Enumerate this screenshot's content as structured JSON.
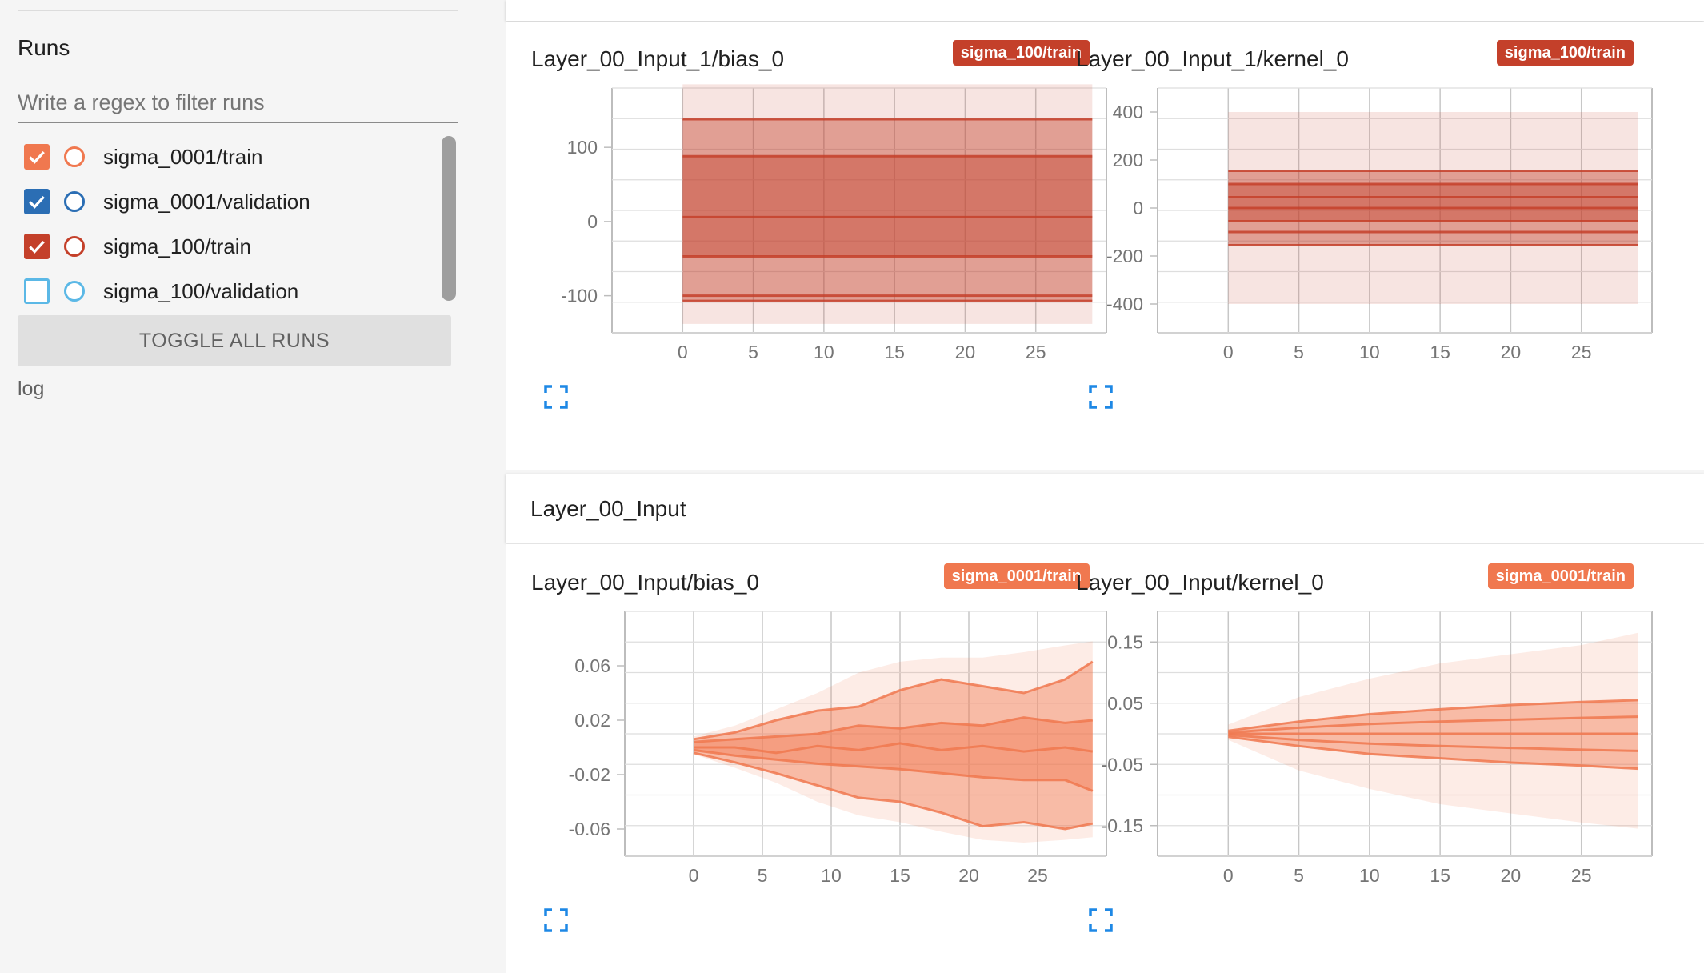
{
  "sidebar": {
    "title": "Runs",
    "filter_placeholder": "Write a regex to filter runs",
    "runs": [
      {
        "label": "sigma_0001/train",
        "checked": true,
        "color": "#f0784f"
      },
      {
        "label": "sigma_0001/validation",
        "checked": true,
        "color": "#2b6eb4"
      },
      {
        "label": "sigma_100/train",
        "checked": true,
        "color": "#c4402a"
      },
      {
        "label": "sigma_100/validation",
        "checked": false,
        "color": "#5bb8e6"
      }
    ],
    "toggle_label": "TOGGLE ALL RUNS",
    "log_label": "log"
  },
  "sections": [
    {
      "title": "",
      "charts": [
        "Layer_00_Input_1/bias_0",
        "Layer_00_Input_1/kernel_0"
      ]
    },
    {
      "title": "Layer_00_Input",
      "charts": [
        "Layer_00_Input/bias_0",
        "Layer_00_Input/kernel_0"
      ]
    }
  ],
  "chart_data": [
    {
      "type": "area",
      "title": "Layer_00_Input_1/bias_0",
      "run": "sigma_100/train",
      "color": "#c4402a",
      "x_ticks": [
        0,
        5,
        10,
        15,
        20,
        25
      ],
      "y_ticks": [
        -100,
        0,
        100
      ],
      "xlim": [
        -5,
        30
      ],
      "ylim": [
        -150,
        180
      ],
      "steps": [
        0,
        29
      ],
      "bands": [
        {
          "low": [
            -138,
            -138
          ],
          "high": [
            185,
            185
          ]
        },
        {
          "low": [
            -107,
            -107
          ],
          "high": [
            138,
            138
          ]
        },
        {
          "low": [
            -47,
            -47
          ],
          "high": [
            88,
            88
          ]
        }
      ],
      "lines": [
        [
          -107,
          -107
        ],
        [
          -100,
          -100
        ],
        [
          -47,
          -47
        ],
        [
          6,
          6
        ],
        [
          88,
          88
        ],
        [
          138,
          138
        ]
      ]
    },
    {
      "type": "area",
      "title": "Layer_00_Input_1/kernel_0",
      "run": "sigma_100/train",
      "color": "#c4402a",
      "x_ticks": [
        0,
        5,
        10,
        15,
        20,
        25
      ],
      "y_ticks": [
        -400,
        -200,
        0,
        200,
        400
      ],
      "xlim": [
        -5,
        30
      ],
      "ylim": [
        -520,
        500
      ],
      "steps": [
        0,
        29
      ],
      "bands": [
        {
          "low": [
            -400,
            -400
          ],
          "high": [
            400,
            400
          ]
        },
        {
          "low": [
            -155,
            -155
          ],
          "high": [
            155,
            155
          ]
        },
        {
          "low": [
            -55,
            -55
          ],
          "high": [
            100,
            100
          ]
        }
      ],
      "lines": [
        [
          -155,
          -155
        ],
        [
          -100,
          -100
        ],
        [
          -55,
          -55
        ],
        [
          0,
          0
        ],
        [
          45,
          45
        ],
        [
          100,
          100
        ],
        [
          155,
          155
        ]
      ]
    },
    {
      "type": "area",
      "title": "Layer_00_Input/bias_0",
      "run": "sigma_0001/train",
      "color": "#f0784f",
      "x_ticks": [
        0,
        5,
        10,
        15,
        20,
        25
      ],
      "y_ticks": [
        -0.06,
        -0.02,
        0.02,
        0.06
      ],
      "xlim": [
        -5,
        30
      ],
      "ylim": [
        -0.08,
        0.1
      ],
      "steps": [
        0,
        3,
        6,
        9,
        12,
        15,
        18,
        21,
        24,
        27,
        29
      ],
      "bands": [
        {
          "low": [
            -0.005,
            -0.015,
            -0.026,
            -0.04,
            -0.05,
            -0.055,
            -0.062,
            -0.068,
            -0.07,
            -0.068,
            -0.066
          ],
          "high": [
            0.008,
            0.016,
            0.028,
            0.04,
            0.055,
            0.063,
            0.066,
            0.066,
            0.07,
            0.075,
            0.078
          ]
        },
        {
          "low": [
            -0.004,
            -0.011,
            -0.019,
            -0.028,
            -0.037,
            -0.04,
            -0.048,
            -0.058,
            -0.055,
            -0.06,
            -0.056
          ],
          "high": [
            0.006,
            0.011,
            0.02,
            0.027,
            0.03,
            0.042,
            0.05,
            0.045,
            0.04,
            0.05,
            0.063
          ]
        },
        {
          "low": [
            -0.002,
            -0.006,
            -0.009,
            -0.012,
            -0.014,
            -0.016,
            -0.019,
            -0.022,
            -0.024,
            -0.024,
            -0.032
          ],
          "high": [
            0.004,
            0.006,
            0.008,
            0.01,
            0.016,
            0.014,
            0.018,
            0.016,
            0.022,
            0.018,
            0.02
          ]
        }
      ],
      "lines": [
        [
          -0.004,
          -0.011,
          -0.019,
          -0.028,
          -0.037,
          -0.04,
          -0.048,
          -0.058,
          -0.055,
          -0.06,
          -0.056
        ],
        [
          -0.002,
          -0.006,
          -0.009,
          -0.012,
          -0.014,
          -0.016,
          -0.019,
          -0.022,
          -0.024,
          -0.024,
          -0.032
        ],
        [
          0.0,
          0.0,
          -0.004,
          0.001,
          -0.002,
          0.003,
          -0.002,
          0.001,
          -0.003,
          0.0,
          -0.003
        ],
        [
          0.004,
          0.006,
          0.008,
          0.01,
          0.016,
          0.014,
          0.018,
          0.016,
          0.022,
          0.018,
          0.02
        ],
        [
          0.006,
          0.011,
          0.02,
          0.027,
          0.03,
          0.042,
          0.05,
          0.045,
          0.04,
          0.05,
          0.063
        ]
      ]
    },
    {
      "type": "area",
      "title": "Layer_00_Input/kernel_0",
      "run": "sigma_0001/train",
      "color": "#f0784f",
      "x_ticks": [
        0,
        5,
        10,
        15,
        20,
        25
      ],
      "y_ticks": [
        -0.15,
        -0.05,
        0.05,
        0.15
      ],
      "xlim": [
        -5,
        30
      ],
      "ylim": [
        -0.2,
        0.2
      ],
      "steps": [
        0,
        5,
        10,
        15,
        20,
        25,
        29
      ],
      "bands": [
        {
          "low": [
            -0.01,
            -0.06,
            -0.09,
            -0.115,
            -0.13,
            -0.145,
            -0.155
          ],
          "high": [
            0.015,
            0.06,
            0.09,
            0.115,
            0.13,
            0.145,
            0.165
          ]
        },
        {
          "low": [
            -0.005,
            -0.02,
            -0.033,
            -0.04,
            -0.047,
            -0.052,
            -0.057
          ],
          "high": [
            0.005,
            0.02,
            0.032,
            0.04,
            0.047,
            0.052,
            0.055
          ]
        }
      ],
      "lines": [
        [
          -0.005,
          -0.02,
          -0.033,
          -0.04,
          -0.047,
          -0.052,
          -0.057
        ],
        [
          -0.002,
          -0.01,
          -0.016,
          -0.02,
          -0.023,
          -0.026,
          -0.028
        ],
        [
          0.0,
          0.0,
          0.0,
          0.0,
          0.0,
          0.0,
          0.0
        ],
        [
          0.002,
          0.01,
          0.016,
          0.02,
          0.023,
          0.026,
          0.028
        ],
        [
          0.005,
          0.02,
          0.032,
          0.04,
          0.047,
          0.052,
          0.055
        ]
      ]
    }
  ]
}
